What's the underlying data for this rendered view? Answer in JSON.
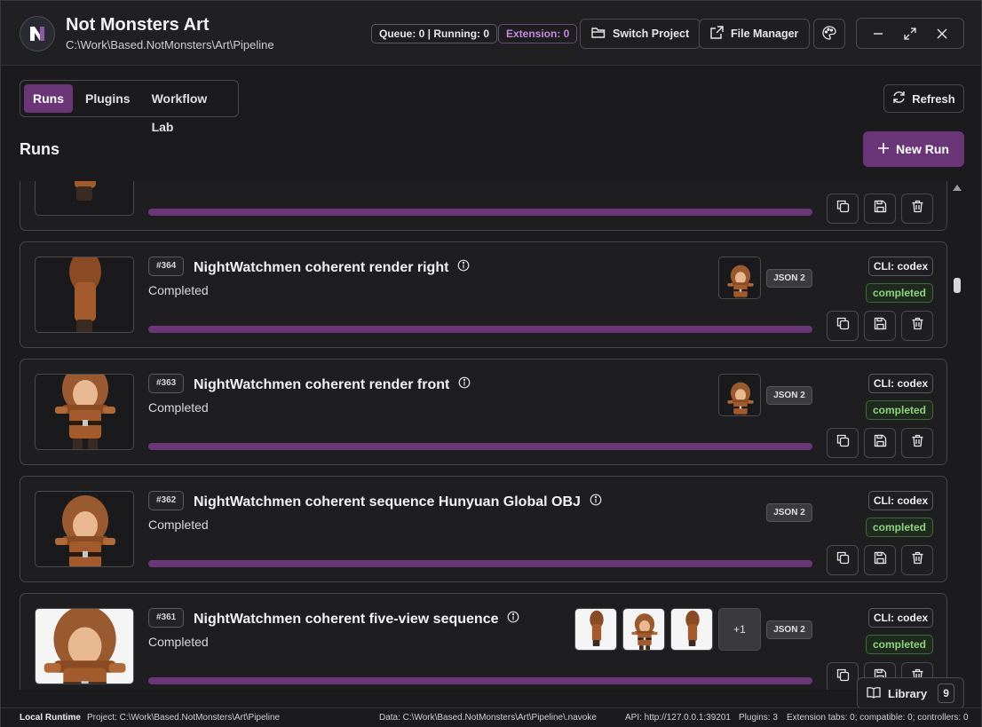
{
  "app": {
    "title": "Not Monsters Art",
    "path": "C:\\Work\\Based.NotMonsters\\Art\\Pipeline"
  },
  "header": {
    "queue_status": "Queue: 0 | Running: 0",
    "extension_status": "Extension: 0",
    "switch_project": "Switch Project",
    "file_manager": "File Manager"
  },
  "tabs": [
    {
      "label": "Runs",
      "active": true
    },
    {
      "label": "Plugins",
      "active": false
    },
    {
      "label": "Workflow Lab",
      "active": false
    }
  ],
  "toolbar": {
    "refresh": "Refresh",
    "new_run": "New Run"
  },
  "section": {
    "title": "Runs"
  },
  "runs": [
    {
      "number": "#364",
      "title": "NightWatchmen coherent render right",
      "status": "Completed",
      "json": "JSON 2",
      "cli": "CLI: codex",
      "state": "completed",
      "progress": 1.0
    },
    {
      "number": "#363",
      "title": "NightWatchmen coherent render front",
      "status": "Completed",
      "json": "JSON 2",
      "cli": "CLI: codex",
      "state": "completed",
      "progress": 1.0
    },
    {
      "number": "#362",
      "title": "NightWatchmen coherent sequence Hunyuan Global OBJ",
      "status": "Completed",
      "json": "JSON 2",
      "cli": "CLI: codex",
      "state": "completed",
      "progress": 1.0
    },
    {
      "number": "#361",
      "title": "NightWatchmen coherent five-view sequence",
      "status": "Completed",
      "json": "JSON 2",
      "cli": "CLI: codex",
      "state": "completed",
      "extra_outputs": "+1",
      "progress": 1.0
    }
  ],
  "library": {
    "label": "Library",
    "count": "9"
  },
  "statusbar": {
    "runtime": "Local Runtime",
    "project": "Project: C:\\Work\\Based.NotMonsters\\Art\\Pipeline",
    "data": "Data: C:\\Work\\Based.NotMonsters\\Art\\Pipeline\\.navoke",
    "api": "API: http://127.0.0.1:39201",
    "plugins": "Plugins: 3",
    "extensions": "Extension tabs: 0; compatible: 0; controllers: 0"
  },
  "colors": {
    "accent": "#6b3678",
    "success": "#8fd37e",
    "extension": "#c58ae0"
  },
  "icons": [
    "app-logo",
    "folder-open-icon",
    "external-link-icon",
    "palette-icon",
    "minimize-icon",
    "maximize-icon",
    "close-icon",
    "refresh-icon",
    "plus-icon",
    "info-icon",
    "copy-icon",
    "save-icon",
    "trash-icon",
    "book-icon"
  ]
}
